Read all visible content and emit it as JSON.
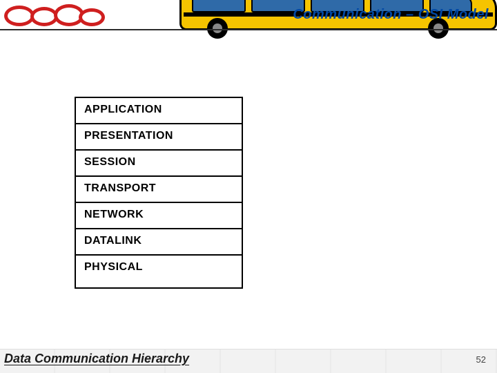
{
  "header": {
    "title": "Communication – OSI Model"
  },
  "osi_layers": [
    "APPLICATION",
    "PRESENTATION",
    "SESSION",
    "TRANSPORT",
    "NETWORK",
    "DATALINK",
    "PHYSICAL"
  ],
  "footer": {
    "caption": "Data Communication Hierarchy",
    "page_number": "52"
  }
}
